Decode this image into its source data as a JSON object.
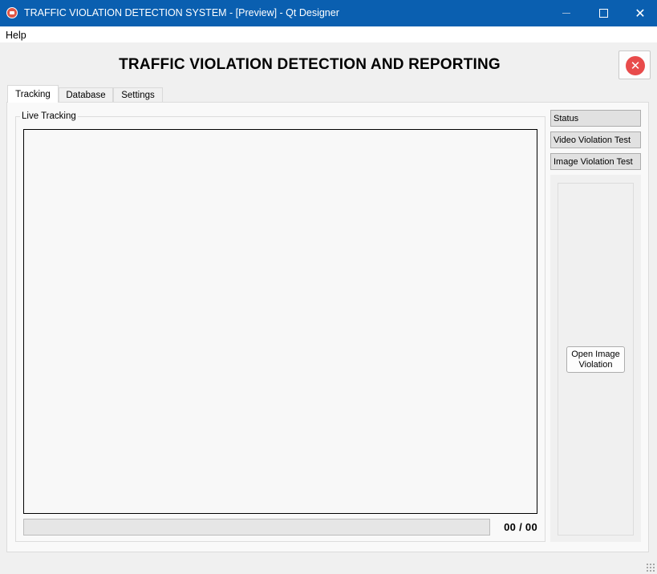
{
  "window": {
    "title": "TRAFFIC VIOLATION DETECTION SYSTEM - [Preview] - Qt Designer",
    "icon": "car-app-icon",
    "controls": {
      "minimize": "minimize",
      "maximize": "maximize",
      "close": "✕"
    }
  },
  "menubar": {
    "items": [
      {
        "label": "Help"
      }
    ]
  },
  "header": {
    "title": "TRAFFIC VIOLATION DETECTION AND REPORTING",
    "exit_icon": "✕"
  },
  "tabs": [
    {
      "label": "Tracking",
      "active": true
    },
    {
      "label": "Database",
      "active": false
    },
    {
      "label": "Settings",
      "active": false
    }
  ],
  "tracking": {
    "group_title": "Live Tracking",
    "progress_value": 0,
    "counter": "00 / 00"
  },
  "sidebar": {
    "buttons": [
      {
        "label": "Status"
      },
      {
        "label": "Video Violation Test"
      },
      {
        "label": "Image Violation Test"
      }
    ],
    "open_image_button": "Open Image\nViolation"
  },
  "colors": {
    "titlebar": "#0a5fb0",
    "exit_button": "#e84b4b",
    "panel": "#f9f9f9"
  }
}
